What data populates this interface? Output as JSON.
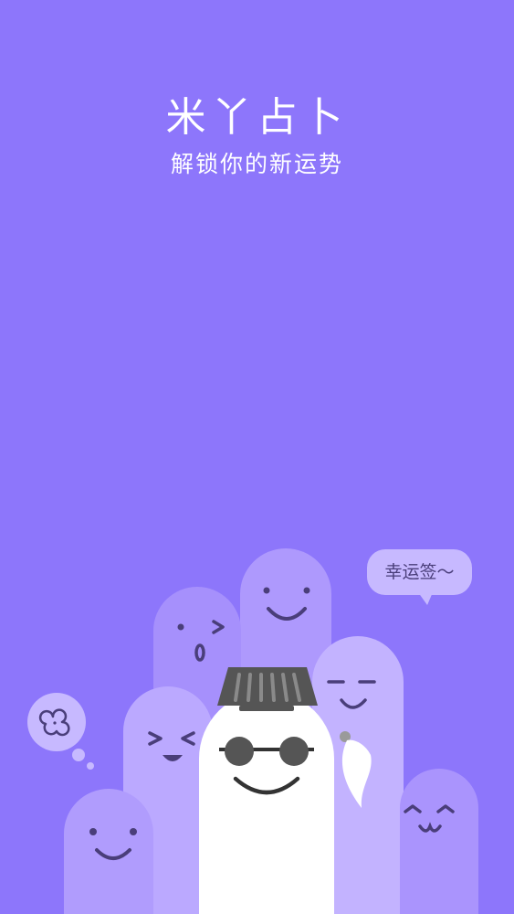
{
  "app": {
    "title": "米丫占卜",
    "subtitle": "解锁你的新运势"
  },
  "bubble": {
    "text": "幸运签～"
  },
  "colors": {
    "background": "#8d76fb",
    "ghost_light": "#c2b2ff",
    "ghost_mid": "#a993fd",
    "ghost_white": "#ffffff",
    "speech_bubble": "#c7b9ff",
    "face_ink": "#4a3e7a"
  },
  "icons": {
    "thought": "clover-icon"
  }
}
